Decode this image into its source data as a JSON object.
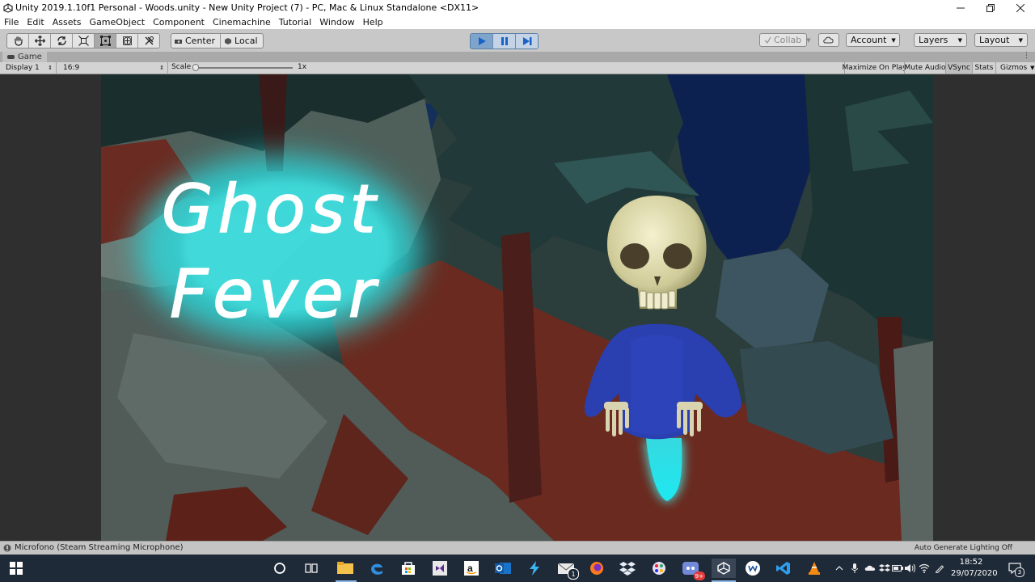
{
  "window": {
    "title": "Unity 2019.1.10f1 Personal - Woods.unity - New Unity Project (7) - PC, Mac & Linux Standalone <DX11>",
    "controls": [
      "minimize-icon",
      "restore-icon",
      "close-icon"
    ]
  },
  "menu": [
    "File",
    "Edit",
    "Assets",
    "GameObject",
    "Component",
    "Cinemachine",
    "Tutorial",
    "Window",
    "Help"
  ],
  "toolbar": {
    "tools": [
      "hand-icon",
      "move-icon",
      "rotate-icon",
      "scale-icon",
      "rect-icon",
      "transform-icon",
      "custom-tool-icon"
    ],
    "active_tool": "rect-icon",
    "pivot_label": "Center",
    "space_label": "Local",
    "play_controls": [
      "play-icon",
      "pause-icon",
      "step-icon"
    ],
    "play_active": true,
    "collab_label": "Collab",
    "account_label": "Account",
    "layers_label": "Layers",
    "layout_label": "Layout"
  },
  "game_view": {
    "tab_label": "Game",
    "display": "Display 1",
    "aspect": "16:9",
    "scale_label": "Scale",
    "scale_value": "1x",
    "scale_fraction": 0.02,
    "toggles": {
      "maximize": "Maximize On Play",
      "mute": "Mute Audio",
      "vsync": "VSync",
      "stats": "Stats",
      "gizmos": "Gizmos"
    },
    "vsync_on": true
  },
  "scene": {
    "logo_line1": "Ghost",
    "logo_line2": "Fever",
    "colors": {
      "sky": "#0c1e4a",
      "tree_dark": "#1c3334",
      "ground_red": "#6b2a1f",
      "ghost_glow": "#3ff0ee",
      "sweater": "#2a3fb0",
      "skull": "#e8e4b8"
    }
  },
  "status": {
    "message": "Microfono (Steam Streaming Microphone)",
    "lighting": "Auto Generate Lighting Off"
  },
  "taskbar": {
    "apps": [
      "start-icon",
      "cortana-icon",
      "task-view-icon",
      "file-explorer-icon",
      "edge-icon",
      "store-icon",
      "visual-studio-icon",
      "amazon-icon",
      "outlook-icon",
      "storm-icon",
      "mail-icon",
      "firefox-icon",
      "dropbox-icon",
      "paint-icon",
      "discord-icon",
      "unity-icon",
      "wattpad-icon",
      "vscode-icon",
      "vlc-icon"
    ],
    "mail_badge": "1",
    "discord_badge": "9+",
    "time": "18:52",
    "date": "29/07/2020",
    "notification_count": "3"
  }
}
